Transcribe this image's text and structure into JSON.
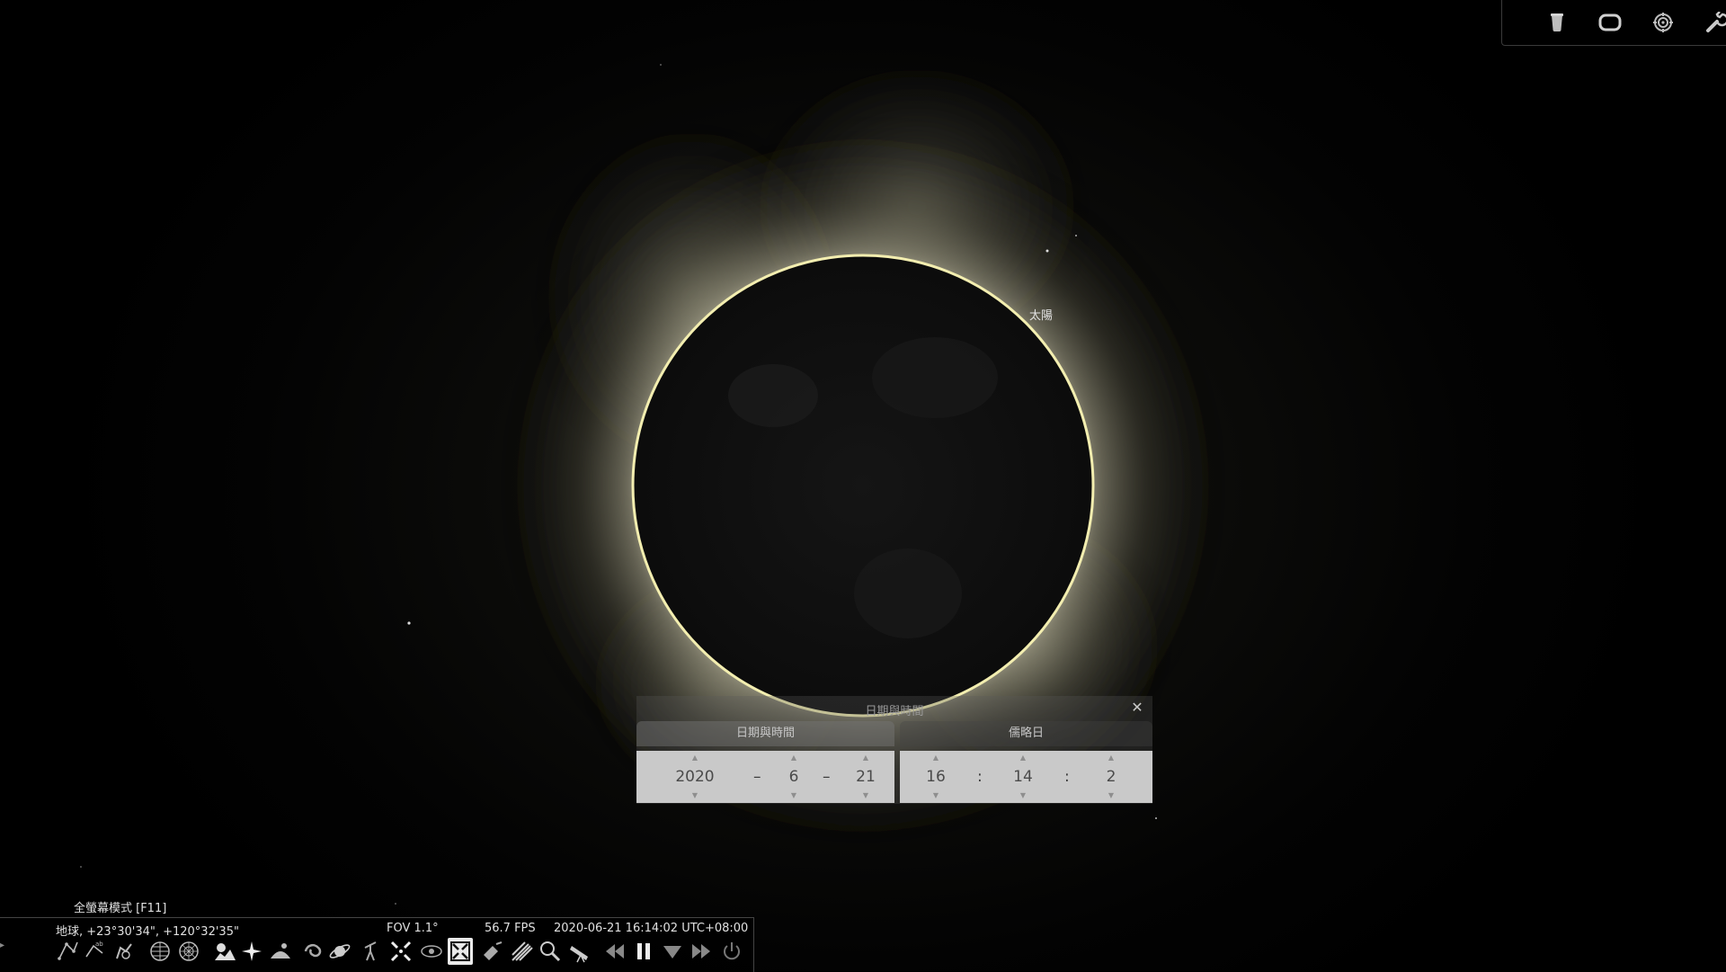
{
  "sky": {
    "object_label": "太陽"
  },
  "top_panel": {
    "buttons": [
      {
        "icon": "bucket-icon"
      },
      {
        "icon": "window-icon"
      },
      {
        "icon": "target-icon"
      },
      {
        "icon": "wrench-icon"
      }
    ]
  },
  "dialog": {
    "title": "日期與時間",
    "close_symbol": "✕",
    "tabs": [
      {
        "label": "日期與時間",
        "active": true
      },
      {
        "label": "儒略日",
        "active": false
      }
    ],
    "date": {
      "year": "2020",
      "month": "6",
      "day": "21",
      "sep": "–"
    },
    "time": {
      "hour": "16",
      "minute": "14",
      "second": "2",
      "sep": ":"
    }
  },
  "hint": "全螢幕模式 [F11]",
  "status_bar": {
    "location": "地球, +23°30'34\", +120°32'35\"",
    "fov": "FOV 1.1°",
    "fps": "56.7 FPS",
    "datetime": "2020-06-21 16:14:02 UTC+08:00"
  },
  "toolbar": {
    "buttons": [
      {
        "icon": "constellation-lines-icon"
      },
      {
        "icon": "constellation-labels-icon"
      },
      {
        "icon": "constellation-art-icon"
      },
      {
        "icon": "equatorial-grid-icon"
      },
      {
        "icon": "azimuthal-grid-icon"
      },
      {
        "icon": "ground-icon"
      },
      {
        "icon": "cardinal-points-icon"
      },
      {
        "icon": "atmosphere-icon"
      },
      {
        "icon": "nebulae-icon"
      },
      {
        "icon": "planet-labels-icon"
      },
      {
        "icon": "mount-toggle-icon"
      },
      {
        "icon": "center-selected-icon"
      },
      {
        "icon": "night-mode-icon"
      },
      {
        "icon": "fullscreen-icon",
        "selected": true
      },
      {
        "icon": "satellites-icon"
      },
      {
        "icon": "meteor-showers-icon"
      },
      {
        "icon": "search-icon"
      },
      {
        "icon": "telescope-icon"
      },
      {
        "icon": "decrease-speed-icon"
      },
      {
        "icon": "pause-icon"
      },
      {
        "icon": "now-icon"
      },
      {
        "icon": "increase-speed-icon"
      },
      {
        "icon": "quit-icon"
      }
    ]
  }
}
